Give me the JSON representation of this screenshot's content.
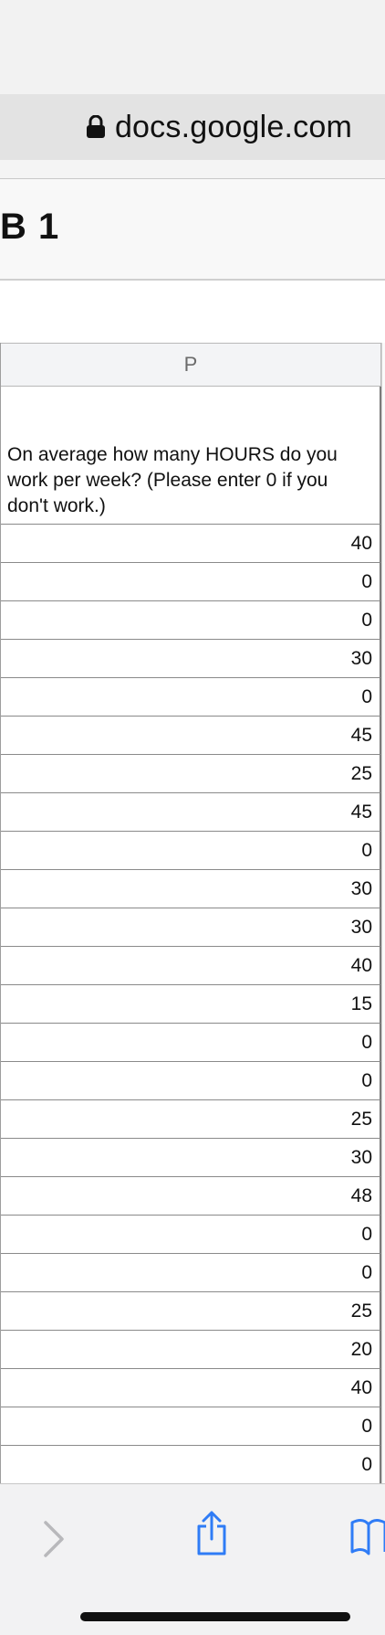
{
  "browser": {
    "url": "docs.google.com"
  },
  "sheet": {
    "title": "B 1"
  },
  "grid": {
    "column_letter": "P",
    "question": "On average how many HOURS do you work per week? (Please enter 0 if you don't work.)",
    "values": [
      "40",
      "0",
      "0",
      "30",
      "0",
      "45",
      "25",
      "45",
      "0",
      "30",
      "30",
      "40",
      "15",
      "0",
      "0",
      "25",
      "30",
      "48",
      "0",
      "0",
      "25",
      "20",
      "40",
      "0",
      "0"
    ]
  },
  "toolbar": {
    "forward_icon": "chevron-right-icon",
    "share_icon": "share-icon",
    "bookmarks_icon": "book-icon",
    "accent": "#2f7cf6"
  }
}
